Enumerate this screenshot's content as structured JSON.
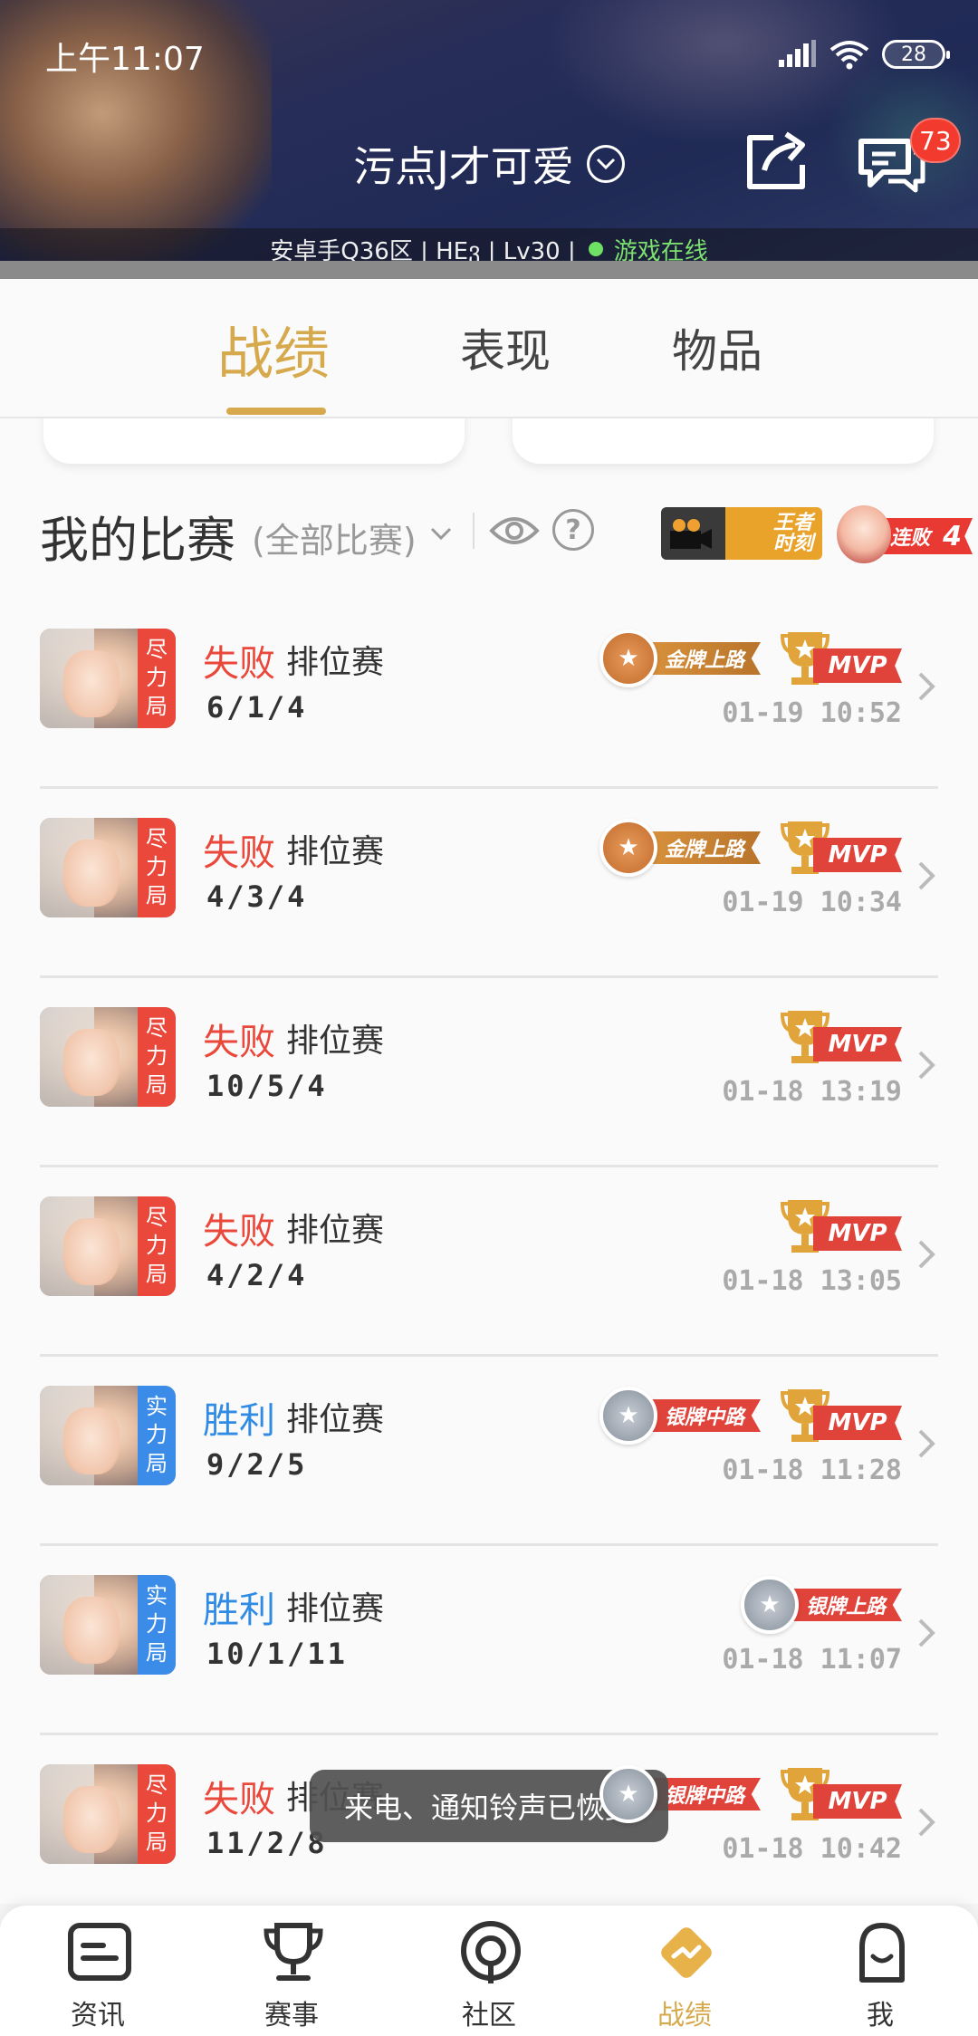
{
  "status_bar": {
    "time": "上午11:07",
    "battery": "28"
  },
  "header": {
    "username": "污点J才可爱",
    "message_badge": "73",
    "server_info": "安卓手Q36区 | HEვ | Lv30 |",
    "online_status": "游戏在线",
    "colors": {
      "online": "#6ee063"
    }
  },
  "tabs": [
    {
      "label": "战绩",
      "active": true
    },
    {
      "label": "表现",
      "active": false
    },
    {
      "label": "物品",
      "active": false
    }
  ],
  "section": {
    "title": "我的比赛",
    "filter": "(全部比赛)",
    "king_moment": "王者\n时刻",
    "streak_label": "连败",
    "streak_count": "4"
  },
  "matches": [
    {
      "mode": "尽力局",
      "result": "失败",
      "outcome": "lose",
      "type": "排位赛",
      "kda": "6/1/4",
      "time": "01-19 10:52",
      "medal": "金牌上路",
      "medal_tier": "gold",
      "mvp": "MVP"
    },
    {
      "mode": "尽力局",
      "result": "失败",
      "outcome": "lose",
      "type": "排位赛",
      "kda": "4/3/4",
      "time": "01-19 10:34",
      "medal": "金牌上路",
      "medal_tier": "gold",
      "mvp": "MVP"
    },
    {
      "mode": "尽力局",
      "result": "失败",
      "outcome": "lose",
      "type": "排位赛",
      "kda": "10/5/4",
      "time": "01-18 13:19",
      "medal": "",
      "medal_tier": "",
      "mvp": "MVP"
    },
    {
      "mode": "尽力局",
      "result": "失败",
      "outcome": "lose",
      "type": "排位赛",
      "kda": "4/2/4",
      "time": "01-18 13:05",
      "medal": "",
      "medal_tier": "",
      "mvp": "MVP"
    },
    {
      "mode": "实力局",
      "result": "胜利",
      "outcome": "win",
      "type": "排位赛",
      "kda": "9/2/5",
      "time": "01-18 11:28",
      "medal": "银牌中路",
      "medal_tier": "silver",
      "mvp": "MVP"
    },
    {
      "mode": "实力局",
      "result": "胜利",
      "outcome": "win",
      "type": "排位赛",
      "kda": "10/1/11",
      "time": "01-18 11:07",
      "medal": "银牌上路",
      "medal_tier": "silver",
      "mvp": ""
    },
    {
      "mode": "尽力局",
      "result": "失败",
      "outcome": "lose",
      "type": "排位赛",
      "kda": "11/2/8",
      "time": "01-18 10:42",
      "medal": "银牌中路",
      "medal_tier": "silver",
      "mvp": "MVP"
    }
  ],
  "toast": "来电、通知铃声已恢复",
  "bottom_nav": [
    {
      "label": "资讯",
      "icon": "news-icon",
      "active": false
    },
    {
      "label": "赛事",
      "icon": "trophy-icon",
      "active": false
    },
    {
      "label": "社区",
      "icon": "community-icon",
      "active": false
    },
    {
      "label": "战绩",
      "icon": "record-icon",
      "active": true
    },
    {
      "label": "我",
      "icon": "profile-icon",
      "active": false
    }
  ],
  "colors": {
    "accent": "#d6a94c",
    "lose": "#e9483a",
    "win": "#3a8ce8"
  }
}
